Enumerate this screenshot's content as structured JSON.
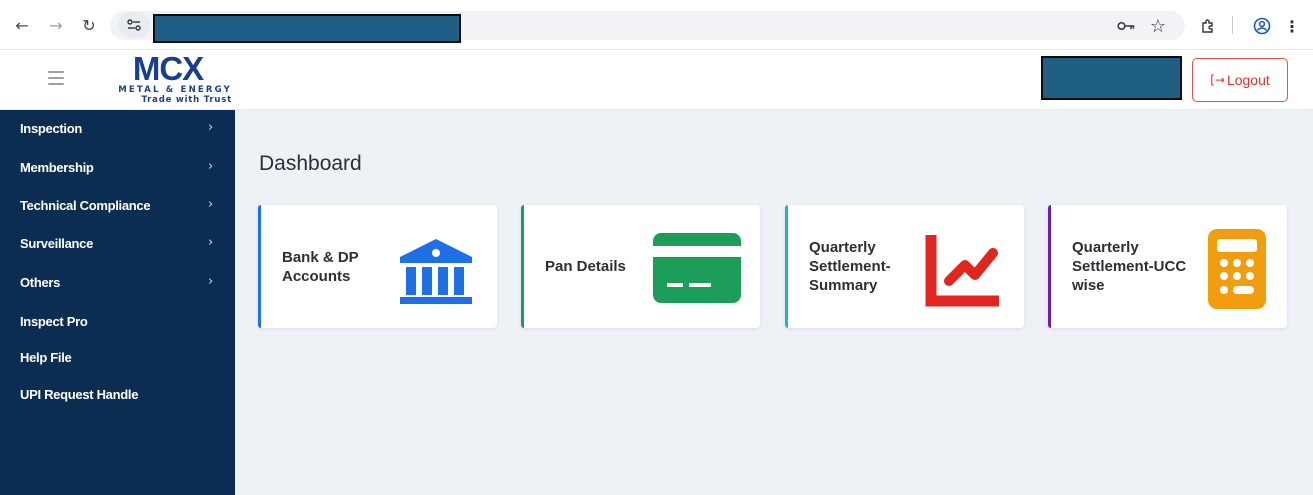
{
  "browser": {
    "nav": {
      "back_icon": "←",
      "forward_icon": "→",
      "reload_icon": "↻"
    },
    "toolbar_icons": [
      "key-icon",
      "star-icon",
      "extensions-icon",
      "profile-icon",
      "menu-icon"
    ]
  },
  "header": {
    "logo": {
      "mark": "MCX",
      "line1": "METAL & ENERGY",
      "line2": "Trade with Trust"
    },
    "logout_label": "Logout",
    "logout_icon": "[→"
  },
  "sidebar": {
    "items": [
      {
        "label": "Inspection",
        "has_submenu": true
      },
      {
        "label": "Membership",
        "has_submenu": true
      },
      {
        "label": "Technical Compliance",
        "has_submenu": true
      },
      {
        "label": "Surveillance",
        "has_submenu": true
      },
      {
        "label": "Others",
        "has_submenu": true
      },
      {
        "label": "Inspect Pro",
        "has_submenu": false
      },
      {
        "label": "Help File",
        "has_submenu": false
      },
      {
        "label": "UPI Request Handle",
        "has_submenu": false
      }
    ],
    "chevron": "›"
  },
  "main": {
    "title": "Dashboard",
    "cards": [
      {
        "label": "Bank & DP Accounts",
        "icon": "bank-icon",
        "accent": "#1f6fe5",
        "icon_color": "#1f6fe5"
      },
      {
        "label": "Pan Details",
        "icon": "card-icon",
        "accent": "#1c9e5a",
        "icon_color": "#1c9e5a"
      },
      {
        "label": "Quarterly Settlement-Summary",
        "icon": "trend-chart-icon",
        "accent": "#1ab8c9",
        "icon_color": "#e0261e"
      },
      {
        "label": "Quarterly Settlement-UCC wise",
        "icon": "calculator-icon",
        "accent": "#6a1fb0",
        "icon_color": "#f29d0f"
      }
    ]
  },
  "colors": {
    "sidebar_bg": "#0b2d52",
    "page_bg": "#eef1f6",
    "logo_blue": "#1b3f8f",
    "logout_red": "#d9332b"
  }
}
